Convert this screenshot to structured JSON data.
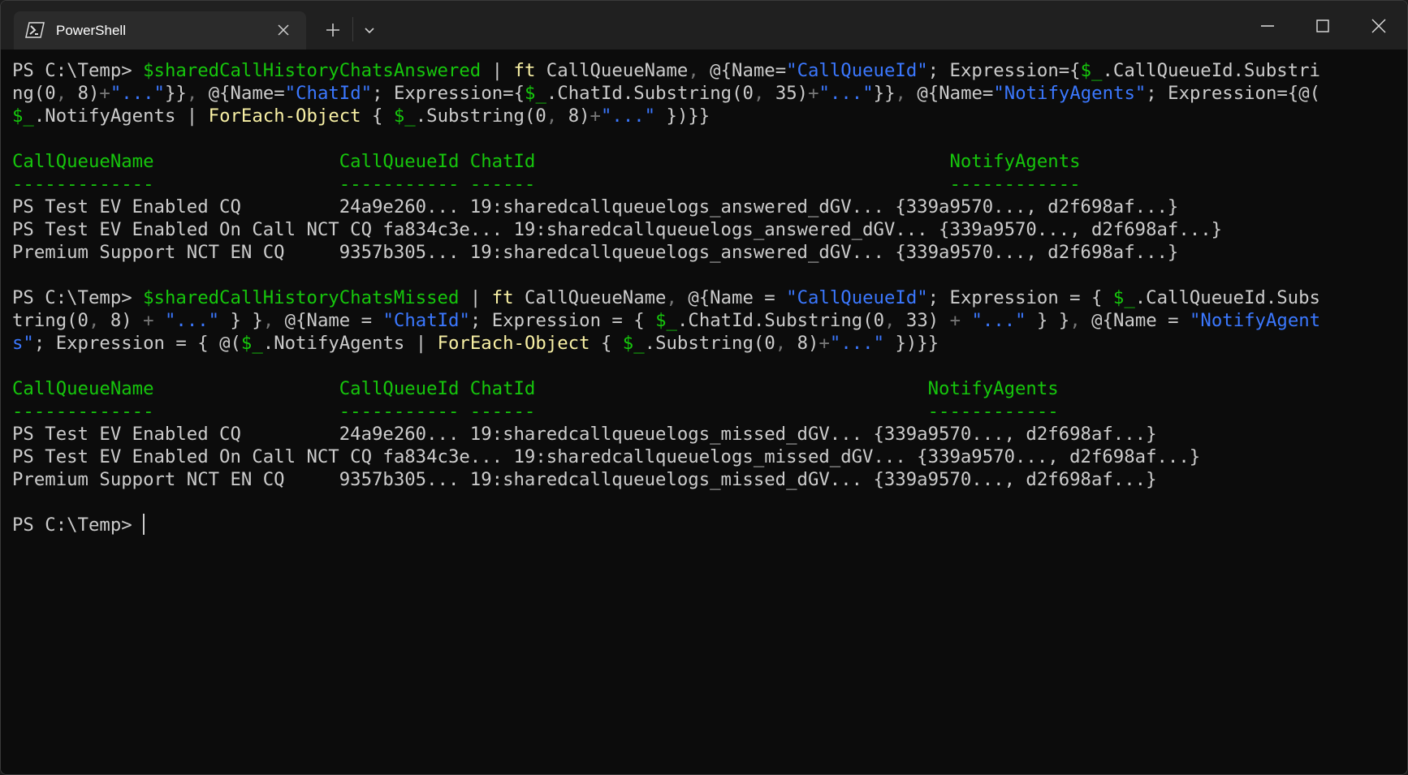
{
  "window": {
    "tab_title": "PowerShell",
    "icons": {
      "tab": "powershell-icon",
      "close_tab": "close-icon",
      "new_tab": "plus-icon",
      "dropdown": "chevron-down-icon",
      "minimize": "minimize-icon",
      "maximize": "maximize-icon",
      "close_window": "close-icon"
    }
  },
  "colors": {
    "background": "#0c0c0c",
    "titlebar": "#202020",
    "tab_active": "#2b2b2b",
    "foreground": "#cccccc",
    "variable": "#16c60c",
    "command": "#f9f1a5",
    "string": "#3b78ff",
    "operator": "#767676",
    "header": "#16c60c"
  },
  "terminal": {
    "commands": [
      {
        "prompt": "PS C:\\Temp> ",
        "lines": [
          [
            [
              "var",
              "$sharedCallHistoryChatsAnswered"
            ],
            [
              "",
              " | "
            ],
            [
              "cmd",
              "ft"
            ],
            [
              "",
              " CallQueueName"
            ],
            [
              "op",
              ","
            ],
            [
              "",
              " @{Name="
            ],
            [
              "str",
              "\"CallQueueId\""
            ],
            [
              "",
              "; Expression={"
            ],
            [
              "var",
              "$_"
            ],
            [
              "",
              ".CallQueueId.Substri"
            ]
          ],
          [
            [
              "",
              "ng(0"
            ],
            [
              "op",
              ","
            ],
            [
              "",
              " 8)"
            ],
            [
              "op",
              "+"
            ],
            [
              "str",
              "\"...\""
            ],
            [
              "",
              "}}"
            ],
            [
              "op",
              ","
            ],
            [
              "",
              " @{Name="
            ],
            [
              "str",
              "\"ChatId\""
            ],
            [
              "",
              "; Expression={"
            ],
            [
              "var",
              "$_"
            ],
            [
              "",
              ".ChatId.Substring(0"
            ],
            [
              "op",
              ","
            ],
            [
              "",
              " 35)"
            ],
            [
              "op",
              "+"
            ],
            [
              "str",
              "\"...\""
            ],
            [
              "",
              "}}"
            ],
            [
              "op",
              ","
            ],
            [
              "",
              " @{Name="
            ],
            [
              "str",
              "\"NotifyAgents\""
            ],
            [
              "",
              "; Expression={@("
            ]
          ],
          [
            [
              "var",
              "$_"
            ],
            [
              "",
              ".NotifyAgents | "
            ],
            [
              "cmd",
              "ForEach-Object"
            ],
            [
              "",
              " { "
            ],
            [
              "var",
              "$_"
            ],
            [
              "",
              ".Substring(0"
            ],
            [
              "op",
              ","
            ],
            [
              "",
              " 8)"
            ],
            [
              "op",
              "+"
            ],
            [
              "str",
              "\"...\""
            ],
            [
              "",
              " })}}"
            ]
          ]
        ],
        "table": {
          "header": "CallQueueName                 CallQueueId ChatId                                      NotifyAgents",
          "underline": "-------------                 ----------- ------                                      ------------",
          "rows": [
            "PS Test EV Enabled CQ         24a9e260... 19:sharedcallqueuelogs_answered_dGV... {339a9570..., d2f698af...}",
            "PS Test EV Enabled On Call NCT CQ fa834c3e... 19:sharedcallqueuelogs_answered_dGV... {339a9570..., d2f698af...}",
            "Premium Support NCT EN CQ     9357b305... 19:sharedcallqueuelogs_answered_dGV... {339a9570..., d2f698af...}"
          ]
        }
      },
      {
        "prompt": "PS C:\\Temp> ",
        "lines": [
          [
            [
              "var",
              "$sharedCallHistoryChatsMissed"
            ],
            [
              "",
              " | "
            ],
            [
              "cmd",
              "ft"
            ],
            [
              "",
              " CallQueueName"
            ],
            [
              "op",
              ","
            ],
            [
              "",
              " @{Name = "
            ],
            [
              "str",
              "\"CallQueueId\""
            ],
            [
              "",
              "; Expression = { "
            ],
            [
              "var",
              "$_"
            ],
            [
              "",
              ".CallQueueId.Subs"
            ]
          ],
          [
            [
              "",
              "tring(0"
            ],
            [
              "op",
              ","
            ],
            [
              "",
              " 8) "
            ],
            [
              "op",
              "+"
            ],
            [
              "",
              " "
            ],
            [
              "str",
              "\"...\""
            ],
            [
              "",
              " } }"
            ],
            [
              "op",
              ","
            ],
            [
              "",
              " @{Name = "
            ],
            [
              "str",
              "\"ChatId\""
            ],
            [
              "",
              "; Expression = { "
            ],
            [
              "var",
              "$_"
            ],
            [
              "",
              ".ChatId.Substring(0"
            ],
            [
              "op",
              ","
            ],
            [
              "",
              " 33) "
            ],
            [
              "op",
              "+"
            ],
            [
              "",
              " "
            ],
            [
              "str",
              "\"...\""
            ],
            [
              "",
              " } }"
            ],
            [
              "op",
              ","
            ],
            [
              "",
              " @{Name = "
            ],
            [
              "str",
              "\"NotifyAgent"
            ]
          ],
          [
            [
              "str",
              "s\""
            ],
            [
              "",
              "; Expression = { @("
            ],
            [
              "var",
              "$_"
            ],
            [
              "",
              ".NotifyAgents | "
            ],
            [
              "cmd",
              "ForEach-Object"
            ],
            [
              "",
              " { "
            ],
            [
              "var",
              "$_"
            ],
            [
              "",
              ".Substring(0"
            ],
            [
              "op",
              ","
            ],
            [
              "",
              " 8)"
            ],
            [
              "op",
              "+"
            ],
            [
              "str",
              "\"...\""
            ],
            [
              "",
              " })}}"
            ]
          ]
        ],
        "table": {
          "header": "CallQueueName                 CallQueueId ChatId                                    NotifyAgents",
          "underline": "-------------                 ----------- ------                                    ------------",
          "rows": [
            "PS Test EV Enabled CQ         24a9e260... 19:sharedcallqueuelogs_missed_dGV... {339a9570..., d2f698af...}",
            "PS Test EV Enabled On Call NCT CQ fa834c3e... 19:sharedcallqueuelogs_missed_dGV... {339a9570..., d2f698af...}",
            "Premium Support NCT EN CQ     9357b305... 19:sharedcallqueuelogs_missed_dGV... {339a9570..., d2f698af...}"
          ]
        }
      }
    ],
    "final_prompt": "PS C:\\Temp> "
  }
}
